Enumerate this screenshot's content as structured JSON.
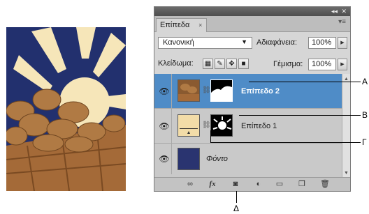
{
  "panel": {
    "tab_label": "Επίπεδα",
    "tab_close": "×",
    "panel_collapse": "◂◂",
    "panel_close": "✕",
    "panel_menu": "▾≡",
    "blend_mode": "Κανονική",
    "opacity_label": "Αδιαφάνεια:",
    "opacity_value": "100%",
    "lock_label": "Κλείδωμα:",
    "fill_label": "Γέμισμα:",
    "fill_value": "100%"
  },
  "layers": [
    {
      "name": "Επίπεδο 2",
      "selected": true
    },
    {
      "name": "Επίπεδο 1",
      "selected": false
    },
    {
      "name": "Φόντο",
      "selected": false
    }
  ],
  "bottom_icons": [
    "link-icon",
    "fx-icon",
    "mask-icon",
    "adjustment-icon",
    "folder-icon",
    "new-layer-icon",
    "trash-icon"
  ],
  "bottom": {
    "fx_label": "fx"
  },
  "callouts": {
    "a": "Α",
    "b": "Β",
    "c": "Γ",
    "d": "Δ"
  },
  "colors": {
    "selected_row": "#4f8cc7",
    "photo_sky": "#22306e",
    "sun": "#f6e6b9",
    "swatch": "#f2dca8",
    "background_layer": "#2a3470"
  }
}
